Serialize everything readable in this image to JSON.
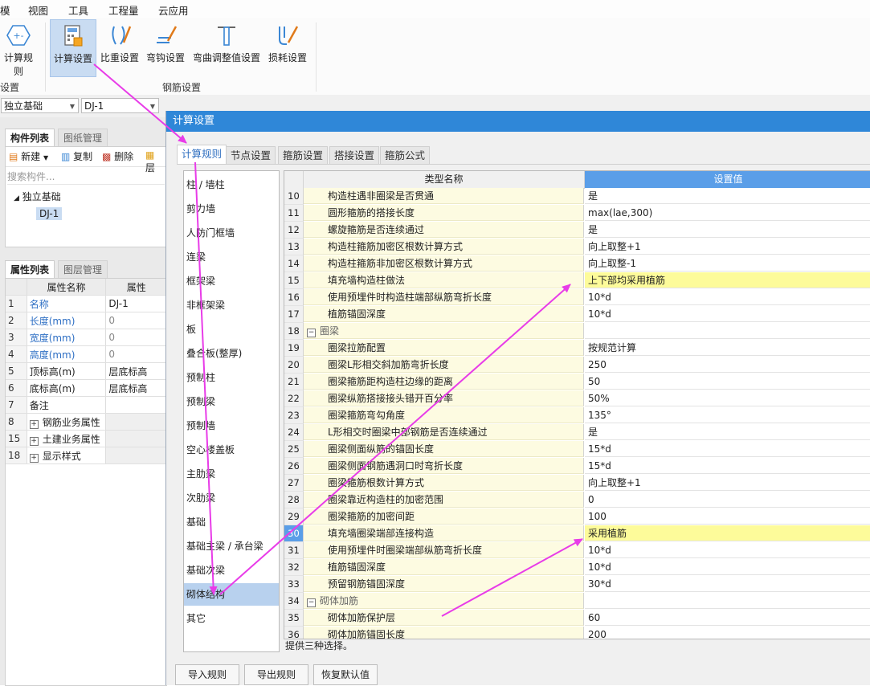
{
  "menu": [
    "模",
    "视图",
    "工具",
    "工程量",
    "云应用"
  ],
  "ribbon": {
    "buttons": [
      {
        "label": "计算规则",
        "icon": "calc-rule-icon"
      },
      {
        "label": "计算设置",
        "icon": "calc-settings-icon"
      },
      {
        "label": "比重设置",
        "icon": "weight-ratio-icon"
      },
      {
        "label": "弯钩设置",
        "icon": "hook-icon"
      },
      {
        "label": "弯曲调整值设置",
        "icon": "bend-adjust-icon"
      },
      {
        "label": "损耗设置",
        "icon": "loss-icon"
      }
    ],
    "groups": [
      "设置",
      "钢筋设置"
    ]
  },
  "selectors": {
    "type": "独立基础",
    "item": "DJ-1"
  },
  "component_panel": {
    "tabs": [
      "构件列表",
      "图纸管理"
    ],
    "toolbar": [
      "新建",
      "复制",
      "删除",
      "层"
    ],
    "search_placeholder": "搜索构件...",
    "tree_root": "独立基础",
    "tree_child": "DJ-1"
  },
  "property_panel": {
    "tabs": [
      "属性列表",
      "图层管理"
    ],
    "header": {
      "name": "属性名称",
      "value": "属性"
    },
    "rows": [
      {
        "num": "1",
        "name": "名称",
        "value": "DJ-1"
      },
      {
        "num": "2",
        "name": "长度(mm)",
        "value": "0"
      },
      {
        "num": "3",
        "name": "宽度(mm)",
        "value": "0"
      },
      {
        "num": "4",
        "name": "高度(mm)",
        "value": "0"
      },
      {
        "num": "5",
        "name": "顶标高(m)",
        "value": "层底标高"
      },
      {
        "num": "6",
        "name": "底标高(m)",
        "value": "层底标高"
      },
      {
        "num": "7",
        "name": "备注",
        "value": ""
      },
      {
        "num": "8",
        "name": "钢筋业务属性",
        "value": ""
      },
      {
        "num": "15",
        "name": "土建业务属性",
        "value": ""
      },
      {
        "num": "18",
        "name": "显示样式",
        "value": ""
      }
    ]
  },
  "dialog": {
    "title": "计算设置",
    "tabs": [
      "计算规则",
      "节点设置",
      "箍筋设置",
      "搭接设置",
      "箍筋公式"
    ],
    "categories": [
      "柱 / 墙柱",
      "剪力墙",
      "人防门框墙",
      "连梁",
      "框架梁",
      "非框架梁",
      "板",
      "叠合板(整厚)",
      "预制柱",
      "预制梁",
      "预制墙",
      "空心楼盖板",
      "主肋梁",
      "次肋梁",
      "基础",
      "基础主梁 / 承台梁",
      "基础次梁",
      "砌体结构",
      "其它"
    ],
    "selected_category": "砌体结构",
    "grid_header": {
      "name": "类型名称",
      "value": "设置值"
    },
    "rows": [
      {
        "num": "10",
        "name": "构造柱遇非圈梁是否贯通",
        "value": "是"
      },
      {
        "num": "11",
        "name": "圆形箍筋的搭接长度",
        "value": "max(lae,300)"
      },
      {
        "num": "12",
        "name": "螺旋箍筋是否连续通过",
        "value": "是"
      },
      {
        "num": "13",
        "name": "构造柱箍筋加密区根数计算方式",
        "value": "向上取整+1"
      },
      {
        "num": "14",
        "name": "构造柱箍筋非加密区根数计算方式",
        "value": "向上取整-1"
      },
      {
        "num": "15",
        "name": "填充墙构造柱做法",
        "value": "上下部均采用植筋",
        "highlight": true
      },
      {
        "num": "16",
        "name": "使用预埋件时构造柱端部纵筋弯折长度",
        "value": "10*d"
      },
      {
        "num": "17",
        "name": "植筋锚固深度",
        "value": "10*d"
      },
      {
        "num": "18",
        "name": "圈梁",
        "value": "",
        "category": true
      },
      {
        "num": "19",
        "name": "圈梁拉筋配置",
        "value": "按规范计算"
      },
      {
        "num": "20",
        "name": "圈梁L形相交斜加筋弯折长度",
        "value": "250"
      },
      {
        "num": "21",
        "name": "圈梁箍筋距构造柱边缘的距离",
        "value": "50"
      },
      {
        "num": "22",
        "name": "圈梁纵筋搭接接头错开百分率",
        "value": "50%"
      },
      {
        "num": "23",
        "name": "圈梁箍筋弯勾角度",
        "value": "135°"
      },
      {
        "num": "24",
        "name": "L形相交时圈梁中部钢筋是否连续通过",
        "value": "是"
      },
      {
        "num": "25",
        "name": "圈梁侧面纵筋的锚固长度",
        "value": "15*d"
      },
      {
        "num": "26",
        "name": "圈梁侧面钢筋遇洞口时弯折长度",
        "value": "15*d"
      },
      {
        "num": "27",
        "name": "圈梁箍筋根数计算方式",
        "value": "向上取整+1"
      },
      {
        "num": "28",
        "name": "圈梁靠近构造柱的加密范围",
        "value": "0"
      },
      {
        "num": "29",
        "name": "圈梁箍筋的加密间距",
        "value": "100"
      },
      {
        "num": "30",
        "name": "填充墙圈梁端部连接构造",
        "value": "采用植筋",
        "highlight": true,
        "current": true
      },
      {
        "num": "31",
        "name": "使用预埋件时圈梁端部纵筋弯折长度",
        "value": "10*d"
      },
      {
        "num": "32",
        "name": "植筋锚固深度",
        "value": "10*d"
      },
      {
        "num": "33",
        "name": "预留钢筋锚固深度",
        "value": "30*d"
      },
      {
        "num": "34",
        "name": "砌体加筋",
        "value": "",
        "category": true
      },
      {
        "num": "35",
        "name": "砌体加筋保护层",
        "value": "60"
      },
      {
        "num": "36",
        "name": "砌体加筋锚固长度",
        "value": "200"
      }
    ],
    "hint": "提供三种选择。",
    "buttons": [
      "导入规则",
      "导出规则",
      "恢复默认值"
    ]
  },
  "colors": {
    "accent": "#2f87d8",
    "annotation": "#e83ce8",
    "highlight": "#fdfb9a",
    "selection": "#b8d1ee"
  }
}
